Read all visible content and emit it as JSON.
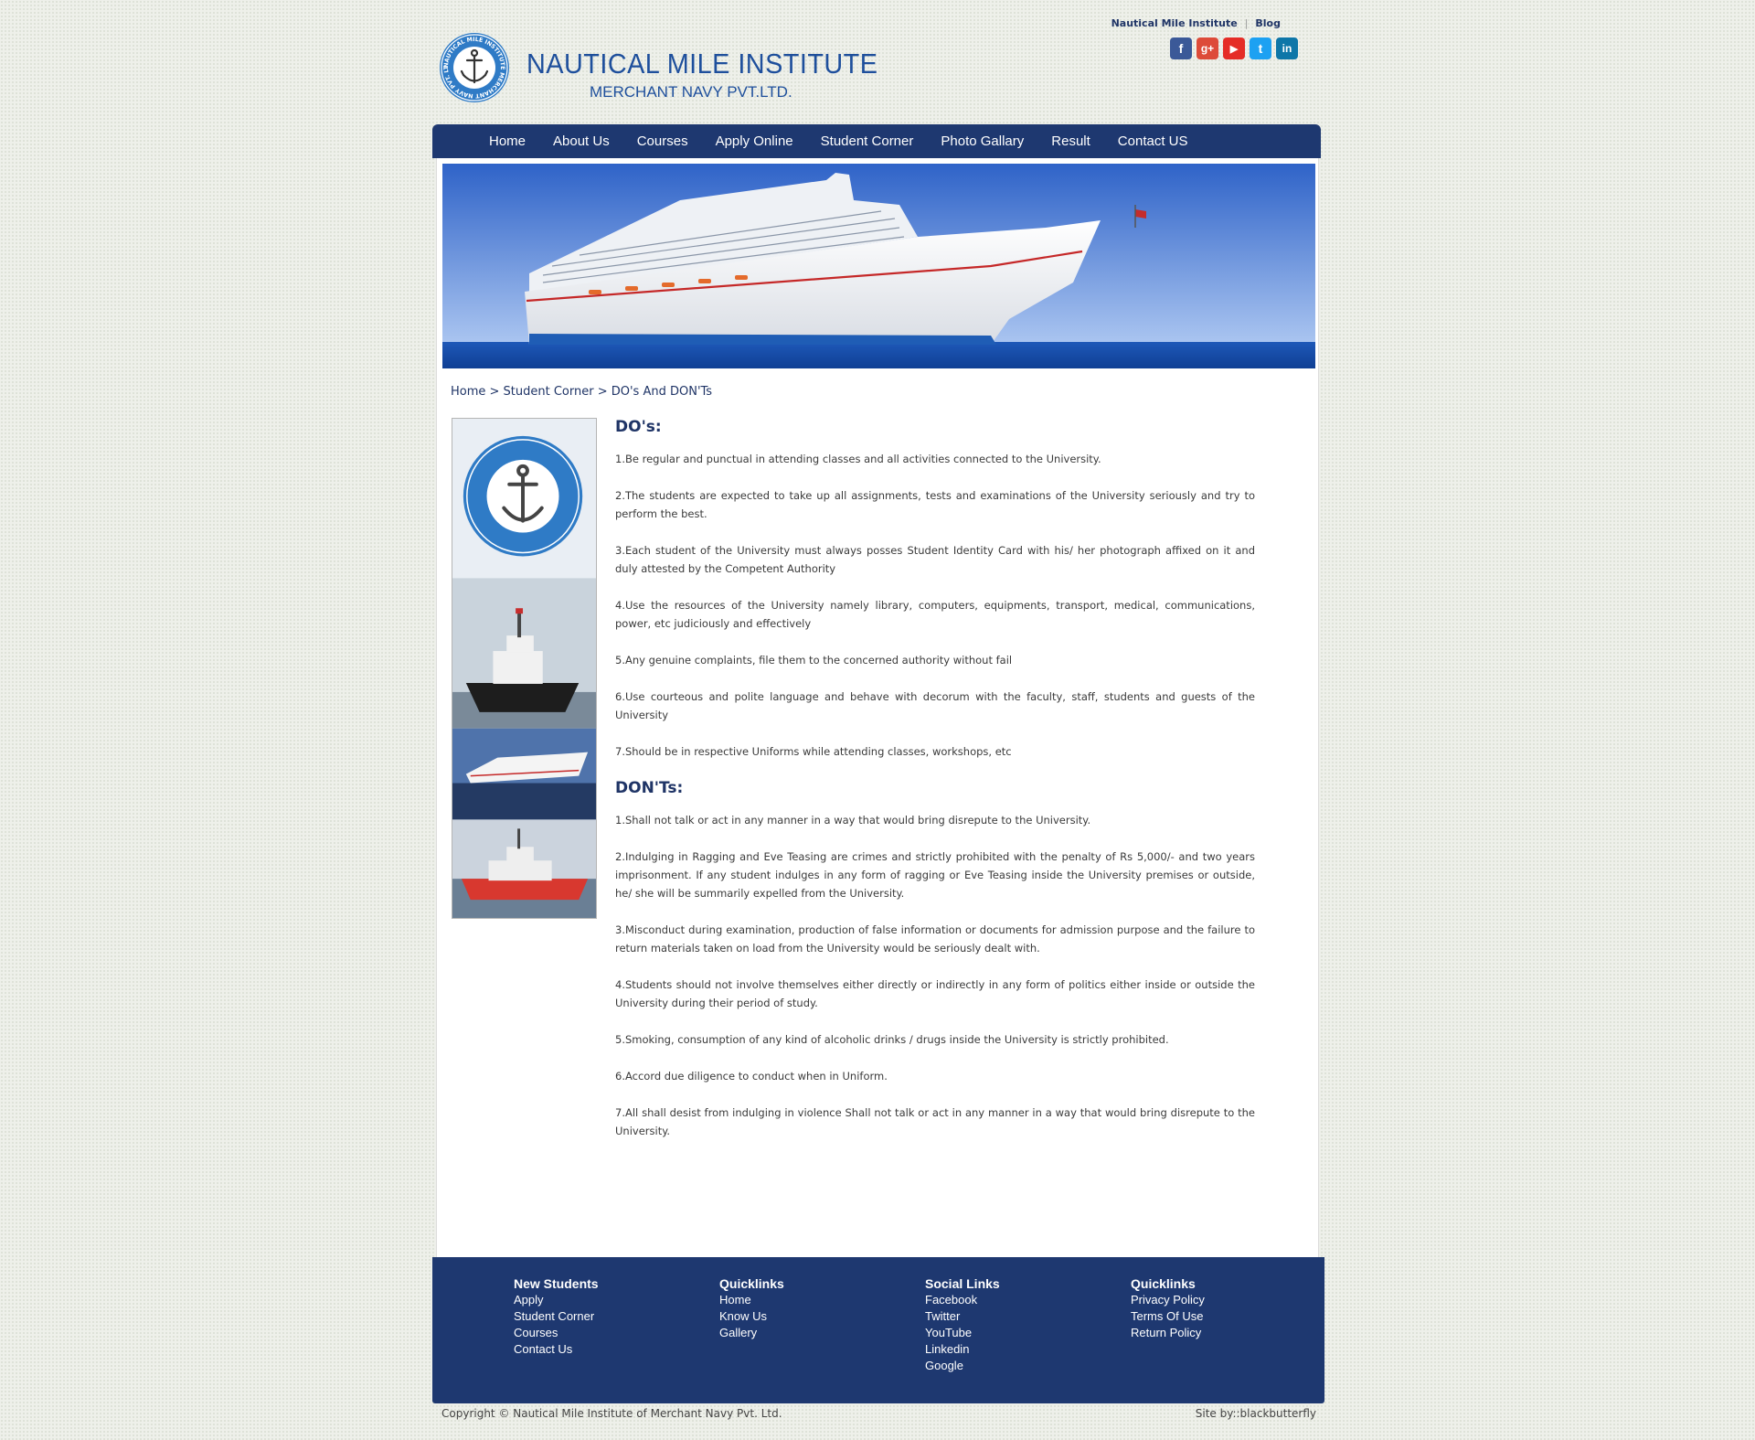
{
  "header": {
    "title": "NAUTICAL MILE INSTITUTE",
    "subtitle": "MERCHANT NAVY PVT.LTD.",
    "logo_text": "NAUTICAL MILE INSTITUTE MERCHANT NAVY PVT. LTD.",
    "top_links": [
      "Nautical Mile Institute",
      "Blog"
    ],
    "social_icons": [
      {
        "name": "facebook-icon",
        "glyph": "f",
        "color": "#3b5998"
      },
      {
        "name": "google-plus-icon",
        "glyph": "g+",
        "color": "#dd4b39"
      },
      {
        "name": "youtube-icon",
        "glyph": "▶",
        "color": "#e52d27"
      },
      {
        "name": "twitter-icon",
        "glyph": "t",
        "color": "#1da1f2"
      },
      {
        "name": "linkedin-icon",
        "glyph": "in",
        "color": "#0e76a8"
      }
    ]
  },
  "nav": {
    "items": [
      "Home",
      "About Us",
      "Courses",
      "Apply Online",
      "Student Corner",
      "Photo Gallary",
      "Result",
      "Contact US"
    ]
  },
  "breadcrumb": "Home > Student Corner > DO's And DON'Ts",
  "content": {
    "dos_heading": "DO's:",
    "dos": [
      "1.Be regular and punctual in attending classes and all activities connected to the University.",
      "2.The students are expected to take up all assignments, tests and examinations of the University seriously and try to perform the best.",
      "3.Each student of the University must always posses Student Identity Card with his/ her photograph affixed on it and duly attested by the Competent Authority",
      "4.Use the resources of the University namely library, computers, equipments, transport, medical, communications, power, etc judiciously and effectively",
      "5.Any genuine complaints, file them to the concerned authority without fail",
      "6.Use courteous and polite language and behave with decorum with the faculty, staff, students and guests of the University",
      "7.Should be in respective Uniforms while attending classes, workshops, etc"
    ],
    "donts_heading": "DON'Ts:",
    "donts": [
      "1.Shall not talk or act in any manner in a way that would bring disrepute to the University.",
      "2.Indulging in Ragging and Eve Teasing are crimes and strictly prohibited with the penalty of Rs 5,000/- and two years imprisonment. If any student indulges in any form of ragging or Eve Teasing inside the University premises or outside, he/ she will be summarily expelled from the University.",
      "3.Misconduct during examination, production of false information or documents for admission purpose and the failure to return materials taken on load from the University would be seriously dealt with.",
      "4.Students should not involve themselves either directly or indirectly in any form of politics either inside or outside the University during their period of study.",
      "5.Smoking, consumption of any kind of alcoholic drinks / drugs inside the University is strictly prohibited.",
      "6.Accord due diligence to conduct when in Uniform.",
      "7.All shall desist from indulging in violence Shall not talk or act in any manner in a way that would bring disrepute to the University."
    ]
  },
  "footer": {
    "columns": [
      {
        "heading": "New Students",
        "links": [
          "Apply",
          "Student Corner",
          "Courses",
          "Contact Us"
        ]
      },
      {
        "heading": "Quicklinks",
        "links": [
          "Home",
          "Know Us",
          "Gallery"
        ]
      },
      {
        "heading": "Social Links",
        "links": [
          "Facebook",
          "Twitter",
          "YouTube",
          "Linkedin",
          "Google"
        ]
      },
      {
        "heading": "Quicklinks",
        "links": [
          "Privacy Policy",
          "Terms Of Use",
          "Return Policy"
        ]
      }
    ],
    "copyright": "Copyright © Nautical Mile Institute of Merchant Navy Pvt. Ltd.",
    "credit": "Site by::blackbutterfly"
  }
}
